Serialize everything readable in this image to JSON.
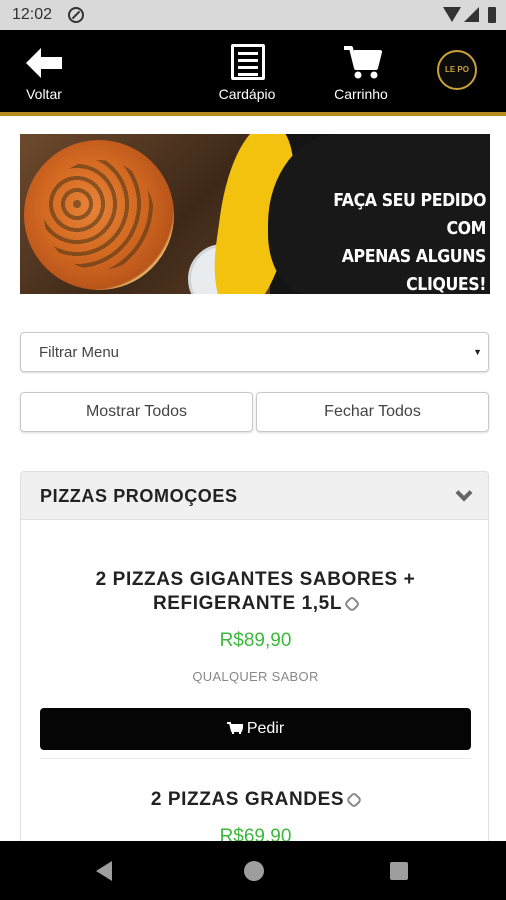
{
  "status_bar": {
    "time": "12:02"
  },
  "top_nav": {
    "back_label": "Voltar",
    "menu_label": "Cardápio",
    "cart_label": "Carrinho",
    "logo_text": "LE PO"
  },
  "banner": {
    "slogan_line1": "FAÇA SEU PEDIDO COM",
    "slogan_line2": "APENAS ALGUNS CLIQUES!"
  },
  "filter": {
    "selected": "Filtrar Menu"
  },
  "buttons": {
    "show_all": "Mostrar Todos",
    "close_all": "Fechar Todos"
  },
  "category": {
    "title": "PIZZAS PROMOÇOES",
    "products": [
      {
        "name": "2 PIZZAS GIGANTES SABORES + REFIGERANTE 1,5L",
        "price": "R$89,90",
        "description": "QUALQUER SABOR",
        "order_label": "Pedir"
      },
      {
        "name": "2 PIZZAS GRANDES",
        "price": "R$69,90"
      }
    ]
  },
  "colors": {
    "accent_gold": "#b78a1e",
    "price_green": "#3cb83c",
    "banner_yellow": "#f2c20f"
  }
}
